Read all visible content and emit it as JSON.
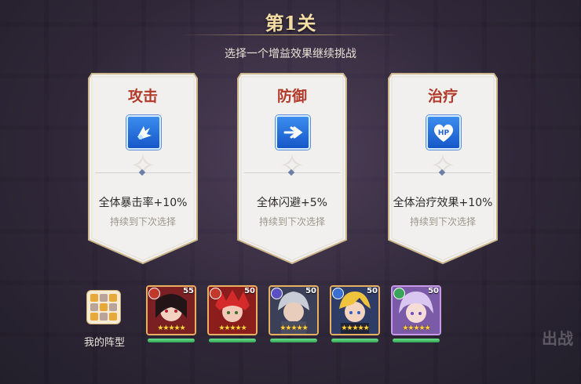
{
  "header": {
    "title": "第1关",
    "subtitle": "选择一个增益效果继续挑战"
  },
  "cards": [
    {
      "title": "攻击",
      "effect": "全体暴击率+10%",
      "note": "持续到下次选择",
      "icon": "crit-burst-icon"
    },
    {
      "title": "防御",
      "effect": "全体闪避+5%",
      "note": "持续到下次选择",
      "icon": "dodge-arrow-icon"
    },
    {
      "title": "治疗",
      "effect": "全体治疗效果+10%",
      "note": "持续到下次选择",
      "icon": "hp-heart-icon",
      "icon_text": "HP"
    }
  ],
  "formation": {
    "label": "我的阵型"
  },
  "heroes": [
    {
      "level": "55",
      "stars": "★★★★★",
      "hp_fraction": 1.0,
      "faction_color": "#c0392b"
    },
    {
      "level": "50",
      "stars": "★★★★★",
      "hp_fraction": 1.0,
      "faction_color": "#c0392b"
    },
    {
      "level": "50",
      "stars": "★★★★★",
      "hp_fraction": 1.0,
      "faction_color": "#5b4fc4"
    },
    {
      "level": "50",
      "stars": "★★★★★",
      "hp_fraction": 1.0,
      "faction_color": "#3a6fd0"
    },
    {
      "level": "50",
      "stars": "★★★★★",
      "hp_fraction": 1.0,
      "faction_color": "#3aa55a"
    }
  ],
  "background_button": {
    "label": "出战"
  },
  "colors": {
    "accent_gold": "#c9ab6f",
    "title_red": "#b23a2a",
    "icon_blue": "#2a72e0",
    "hp_green": "#3fbf62"
  }
}
